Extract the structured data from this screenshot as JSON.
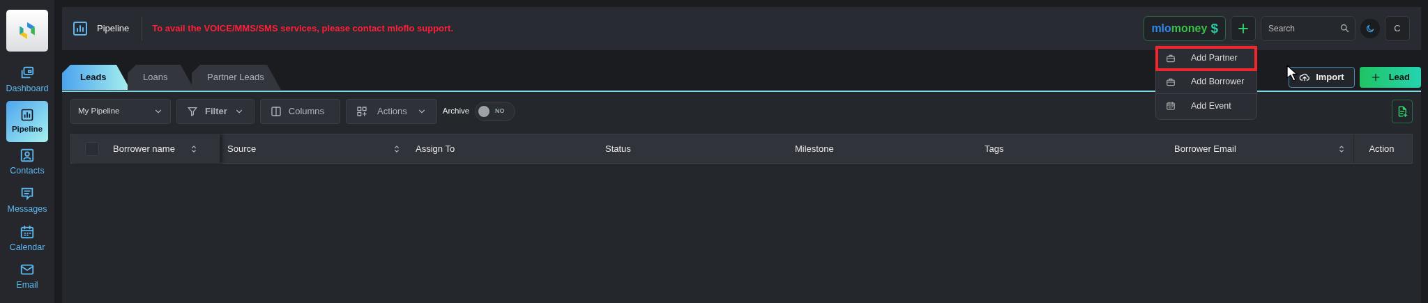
{
  "sidebar": {
    "items": [
      {
        "label": "Dashboard",
        "selected": false
      },
      {
        "label": "Pipeline",
        "selected": true
      },
      {
        "label": "Contacts",
        "selected": false
      },
      {
        "label": "Messages",
        "selected": false
      },
      {
        "label": "Calendar",
        "selected": false
      },
      {
        "label": "Email",
        "selected": false
      }
    ]
  },
  "header": {
    "title": "Pipeline",
    "notice": "To avail the VOICE/MMS/SMS services, please contact mloflo support.",
    "brand": {
      "part_1": "mlo",
      "part_2": "money",
      "symbol": "$"
    },
    "search": {
      "placeholder": "Search"
    },
    "avatar": "C"
  },
  "add_menu": {
    "expanded": true,
    "items": [
      {
        "label": "Add Partner",
        "highlighted": true
      },
      {
        "label": "Add Borrower",
        "highlighted": false
      },
      {
        "label": "Add Event",
        "highlighted": false
      }
    ]
  },
  "tabs": [
    {
      "label": "Leads",
      "selected": true
    },
    {
      "label": "Loans",
      "selected": false
    },
    {
      "label": "Partner Leads",
      "selected": false
    }
  ],
  "actions": {
    "import": "Import",
    "lead": "Lead"
  },
  "toolbar": {
    "view": "My Pipeline",
    "filter": "Filter",
    "columns": "Columns",
    "actions": "Actions",
    "archive": {
      "label": "Archive",
      "on": false,
      "state_text": "NO"
    }
  },
  "table": {
    "select_all_checked": false,
    "columns": [
      {
        "label": "Borrower name",
        "sortable": true
      },
      {
        "label": "Source",
        "sortable": true
      },
      {
        "label": "Assign To",
        "sortable": false
      },
      {
        "label": "Status",
        "sortable": false
      },
      {
        "label": "Milestone",
        "sortable": false
      },
      {
        "label": "Tags",
        "sortable": false
      },
      {
        "label": "Borrower Email",
        "sortable": true
      },
      {
        "label": "Action",
        "sortable": false
      }
    ]
  }
}
